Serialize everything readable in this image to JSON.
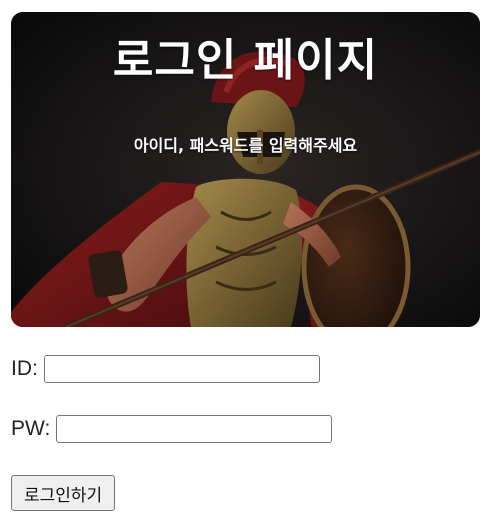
{
  "hero": {
    "title": "로그인 페이지",
    "subtitle": "아이디, 패스워드를 입력해주세요",
    "image": "spartan-warrior-image"
  },
  "form": {
    "id_label": "ID:",
    "id_value": "",
    "pw_label": "PW:",
    "pw_value": "",
    "submit_label": "로그인하기"
  }
}
